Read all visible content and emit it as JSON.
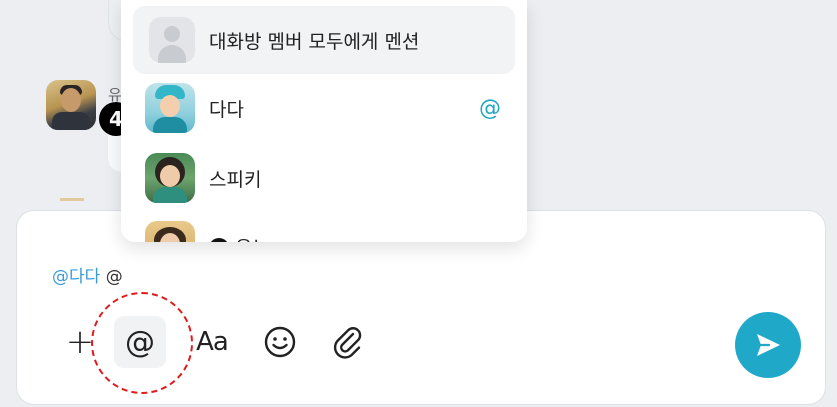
{
  "mention_popup": {
    "items": [
      {
        "name": "대화방 멤버 모두에게 멘션",
        "type": "all"
      },
      {
        "name": "다다",
        "mentioned_marker": "@"
      },
      {
        "name": "스피키"
      },
      {
        "name": "유노"
      }
    ]
  },
  "badge_number": "4",
  "background_chat": {
    "partial_name": "유"
  },
  "composer": {
    "mention_chip": "@다다",
    "typed_text": "@"
  },
  "toolbar": {
    "plus_glyph": "+",
    "mention_glyph": "@",
    "format_glyph": "Aa",
    "emoji_glyph": "☺"
  },
  "icons": [
    "plus-icon",
    "mention-at-icon",
    "text-format-icon",
    "emoji-icon",
    "paperclip-icon",
    "send-icon",
    "user-placeholder-icon"
  ],
  "colors": {
    "accent": "#20a8c9",
    "mention_text": "#3a9bd9",
    "annotation": "#e01b1b",
    "badge": "#000000"
  }
}
